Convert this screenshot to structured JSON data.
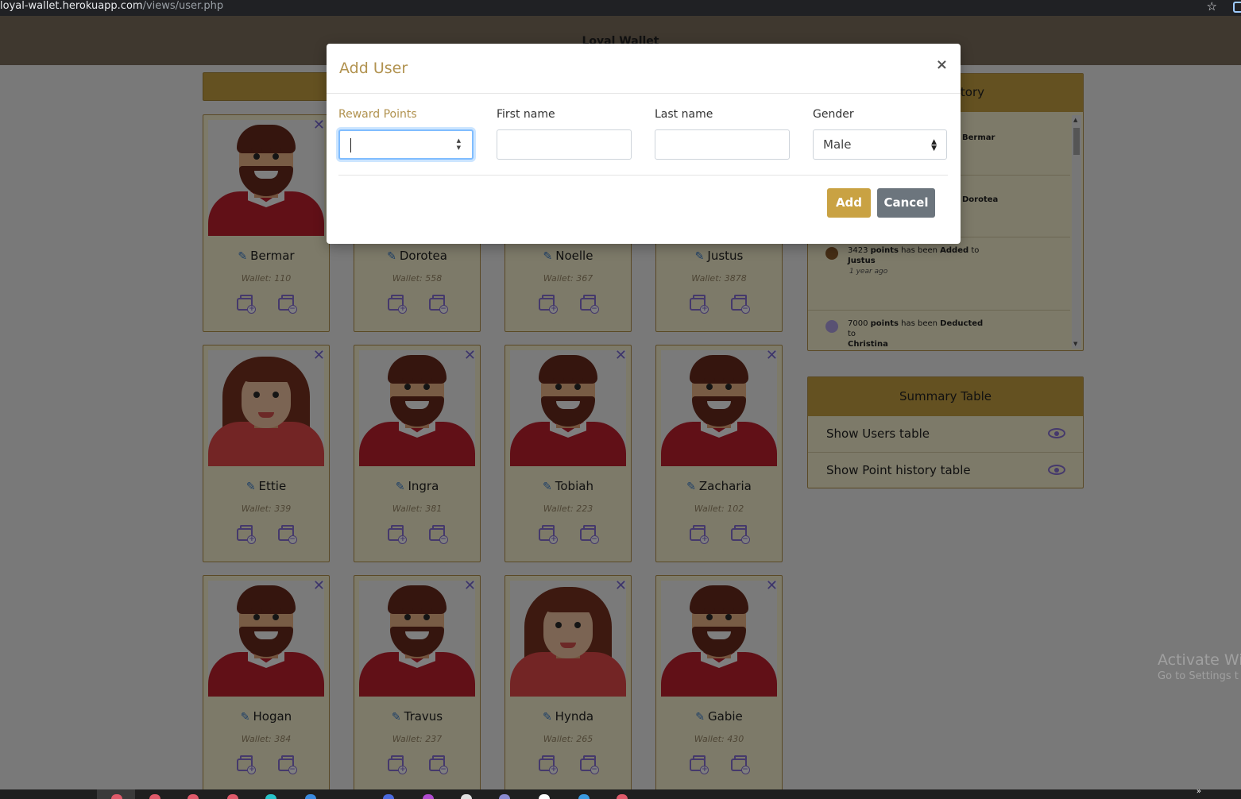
{
  "browser": {
    "url_host": "loyal-wallet.herokuapp.com",
    "url_path": "/views/user.php",
    "bookmark_icon": "star-icon"
  },
  "app": {
    "title": "Loyal Wallet"
  },
  "users": [
    {
      "name": "Bermar",
      "wallet": "Wallet: 110",
      "gender": "male"
    },
    {
      "name": "Dorotea",
      "wallet": "Wallet: 558",
      "gender": "male"
    },
    {
      "name": "Noelle",
      "wallet": "Wallet: 367",
      "gender": "male"
    },
    {
      "name": "Justus",
      "wallet": "Wallet: 3878",
      "gender": "male"
    },
    {
      "name": "Ettie",
      "wallet": "Wallet: 339",
      "gender": "female"
    },
    {
      "name": "Ingra",
      "wallet": "Wallet: 381",
      "gender": "male"
    },
    {
      "name": "Tobiah",
      "wallet": "Wallet: 223",
      "gender": "male"
    },
    {
      "name": "Zacharia",
      "wallet": "Wallet: 102",
      "gender": "male"
    },
    {
      "name": "Hogan",
      "wallet": "Wallet: 384",
      "gender": "male"
    },
    {
      "name": "Travus",
      "wallet": "Wallet: 237",
      "gender": "male"
    },
    {
      "name": "Hynda",
      "wallet": "Wallet: 265",
      "gender": "female"
    },
    {
      "name": "Gabie",
      "wallet": "Wallet: 430",
      "gender": "male"
    }
  ],
  "history": {
    "title_visible": "tory",
    "items": [
      {
        "lead": "",
        "points": "",
        "verb": "",
        "to": "Bermar",
        "ago": "",
        "type": "add"
      },
      {
        "lead": "",
        "points": "",
        "verb": "",
        "to": "Dorotea",
        "ago": "",
        "type": "add"
      },
      {
        "lead": "3423 ",
        "points": "points",
        "mid": " has been ",
        "verb": "Added",
        "tail": " to",
        "to": "Justus",
        "ago": "1 year ago",
        "type": "add"
      },
      {
        "lead": "7000 ",
        "points": "points",
        "mid": " has been ",
        "verb": "Deducted",
        "tail": " to",
        "to": "Christina",
        "ago": "",
        "type": "deduct"
      }
    ]
  },
  "summary": {
    "title": "Summary Table",
    "rows": [
      {
        "label": "Show Users table"
      },
      {
        "label": "Show Point history table"
      }
    ]
  },
  "watermark": {
    "line1": "Activate Wi",
    "line2": "Go to Settings t"
  },
  "modal": {
    "title": "Add User",
    "close": "×",
    "fields": {
      "reward_points": {
        "label": "Reward Points",
        "value": ""
      },
      "first_name": {
        "label": "First name",
        "value": ""
      },
      "last_name": {
        "label": "Last name",
        "value": ""
      },
      "gender": {
        "label": "Gender",
        "value": "Male"
      }
    },
    "add_label": "Add",
    "cancel_label": "Cancel"
  },
  "colors": {
    "accent": "#c9a243",
    "title_gold": "#b1924f",
    "icon_purple": "#8a72d8"
  }
}
